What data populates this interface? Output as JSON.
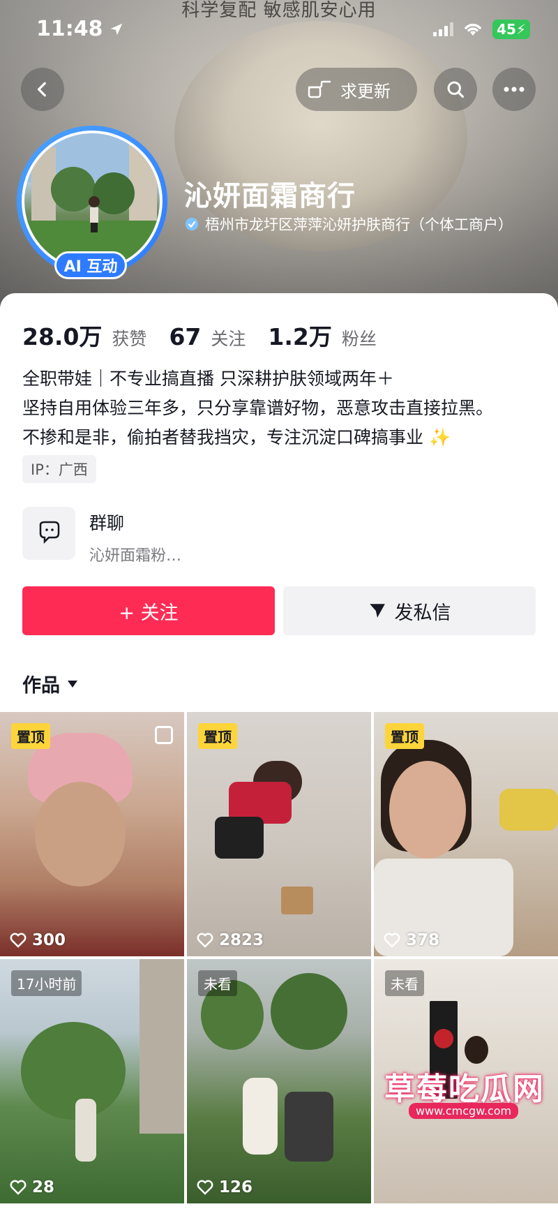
{
  "top_caption": "科学复配 敏感肌安心用",
  "status": {
    "time": "11:48",
    "battery": "45"
  },
  "header": {
    "update_label": "求更新",
    "nickname": "沁妍面霜商行",
    "verification": "梧州市龙圩区萍萍沁妍护肤商行（个体工商户）",
    "ai_badge": "AI 互动"
  },
  "stats": [
    {
      "value": "28.0万",
      "label": "获赞"
    },
    {
      "value": "67",
      "label": "关注"
    },
    {
      "value": "1.2万",
      "label": "粉丝"
    }
  ],
  "bio": [
    "全职带娃｜不专业搞直播 只深耕护肤领域两年＋",
    "坚持自用体验三年多，只分享靠谱好物，恶意攻击直接拉黑。",
    "不掺和是非，偷拍者替我挡灾，专注沉淀口碑搞事业 ✨"
  ],
  "ip": "IP：广西",
  "group": {
    "title": "群聊",
    "subtitle": "沁妍面霜粉…"
  },
  "buttons": {
    "follow": "+ 关注",
    "message": "发私信"
  },
  "works_tab": "作品",
  "videos": [
    {
      "tag": "置顶",
      "likes": "300"
    },
    {
      "tag": "置顶",
      "likes": "2823"
    },
    {
      "tag": "置顶",
      "likes": "378"
    },
    {
      "tag": "17小时前",
      "likes": "28"
    },
    {
      "tag": "未看",
      "likes": "126"
    },
    {
      "tag": "未看",
      "likes": ""
    }
  ],
  "watermark": {
    "title": "草莓吃瓜网",
    "url": "www.cmcgw.com"
  }
}
